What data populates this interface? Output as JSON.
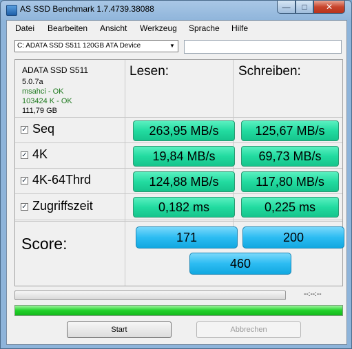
{
  "window": {
    "title": "AS SSD Benchmark 1.7.4739.38088"
  },
  "menu": [
    "Datei",
    "Bearbeiten",
    "Ansicht",
    "Werkzeug",
    "Sprache",
    "Hilfe"
  ],
  "drive": {
    "selected": "C: ADATA SSD S511 120GB ATA Device"
  },
  "info": {
    "name": "ADATA SSD S511",
    "firmware": "5.0.7a",
    "driver": "msahci - OK",
    "alignment": "103424 K - OK",
    "capacity": "111,79 GB"
  },
  "headers": {
    "read": "Lesen:",
    "write": "Schreiben:"
  },
  "rows": [
    {
      "label": "Seq",
      "checked": true,
      "read": "263,95 MB/s",
      "write": "125,67 MB/s"
    },
    {
      "label": "4K",
      "checked": true,
      "read": "19,84 MB/s",
      "write": "69,73 MB/s"
    },
    {
      "label": "4K-64Thrd",
      "checked": true,
      "read": "124,88 MB/s",
      "write": "117,80 MB/s"
    },
    {
      "label": "Zugriffszeit",
      "checked": true,
      "read": "0,182 ms",
      "write": "0,225 ms"
    }
  ],
  "score": {
    "label": "Score:",
    "read": "171",
    "write": "200",
    "total": "460"
  },
  "progress": {
    "time": "--:--:--",
    "upper_fraction": 0.0,
    "lower_fraction": 1.0
  },
  "buttons": {
    "start": "Start",
    "abort": "Abbrechen"
  },
  "colors": {
    "result_green": "#22dba0",
    "score_blue": "#2cbcf2",
    "progress_green": "#22d22a"
  }
}
